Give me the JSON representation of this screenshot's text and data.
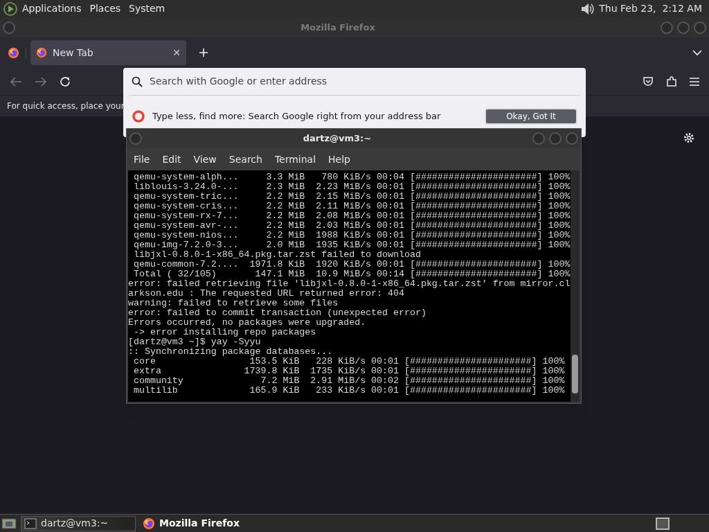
{
  "top_panel": {
    "menus": [
      "Applications",
      "Places",
      "System"
    ],
    "clock": "Thu Feb 23,  2:12 AM"
  },
  "firefox": {
    "title": "Mozilla Firefox",
    "tabs": [
      {
        "label": "New Tab",
        "close": "✕",
        "selected": true
      }
    ],
    "url_placeholder": "Search with Google or enter address",
    "bookmarks_hint": "For quick access, place your",
    "suggestion": {
      "text": "Type less, find more: Search Google right from your address bar",
      "button": "Okay, Got It"
    }
  },
  "terminal": {
    "title": "dartz@vm3:~",
    "menu": [
      "File",
      "Edit",
      "View",
      "Search",
      "Terminal",
      "Help"
    ],
    "lines": [
      " qemu-system-alph...     3.3 MiB   780 KiB/s 00:04 [######################] 100%",
      " liblouis-3.24.0-...     2.3 MiB  2.23 MiB/s 00:01 [######################] 100%",
      " qemu-system-tric...     2.2 MiB  2.15 MiB/s 00:01 [######################] 100%",
      " qemu-system-cris...     2.2 MiB  2.11 MiB/s 00:01 [######################] 100%",
      " qemu-system-rx-7...     2.2 MiB  2.08 MiB/s 00:01 [######################] 100%",
      " qemu-system-avr-...     2.2 MiB  2.03 MiB/s 00:01 [######################] 100%",
      " qemu-system-nios...     2.2 MiB  1988 KiB/s 00:01 [######################] 100%",
      " qemu-img-7.2.0-3...     2.0 MiB  1935 KiB/s 00:01 [######################] 100%",
      " libjxl-0.8.0-1-x86_64.pkg.tar.zst failed to download",
      " qemu-common-7.2....  1971.8 KiB  1920 KiB/s 00:01 [######################] 100%",
      " Total ( 32/105)       147.1 MiB  10.9 MiB/s 00:14 [######################] 100%",
      "error: failed retrieving file 'libjxl-0.8.0-1-x86_64.pkg.tar.zst' from mirror.cl",
      "arkson.edu : The requested URL returned error: 404",
      "warning: failed to retrieve some files",
      "error: failed to commit transaction (unexpected error)",
      "Errors occurred, no packages were upgraded.",
      " -> error installing repo packages",
      "[dartz@vm3 ~]$ yay -Syyu",
      ":: Synchronizing package databases...",
      " core                 153.5 KiB   228 KiB/s 00:01 [######################] 100%",
      " extra               1739.8 KiB  1735 KiB/s 00:01 [######################] 100%",
      " community              7.2 MiB  2.91 MiB/s 00:02 [######################] 100%",
      " multilib             165.9 KiB   233 KiB/s 00:01 [######################] 100%"
    ]
  },
  "taskbar": {
    "items": [
      {
        "label": "dartz@vm3:~",
        "kind": "terminal",
        "selected": true
      },
      {
        "label": "Mozilla Firefox",
        "kind": "firefox",
        "selected": false
      }
    ]
  }
}
